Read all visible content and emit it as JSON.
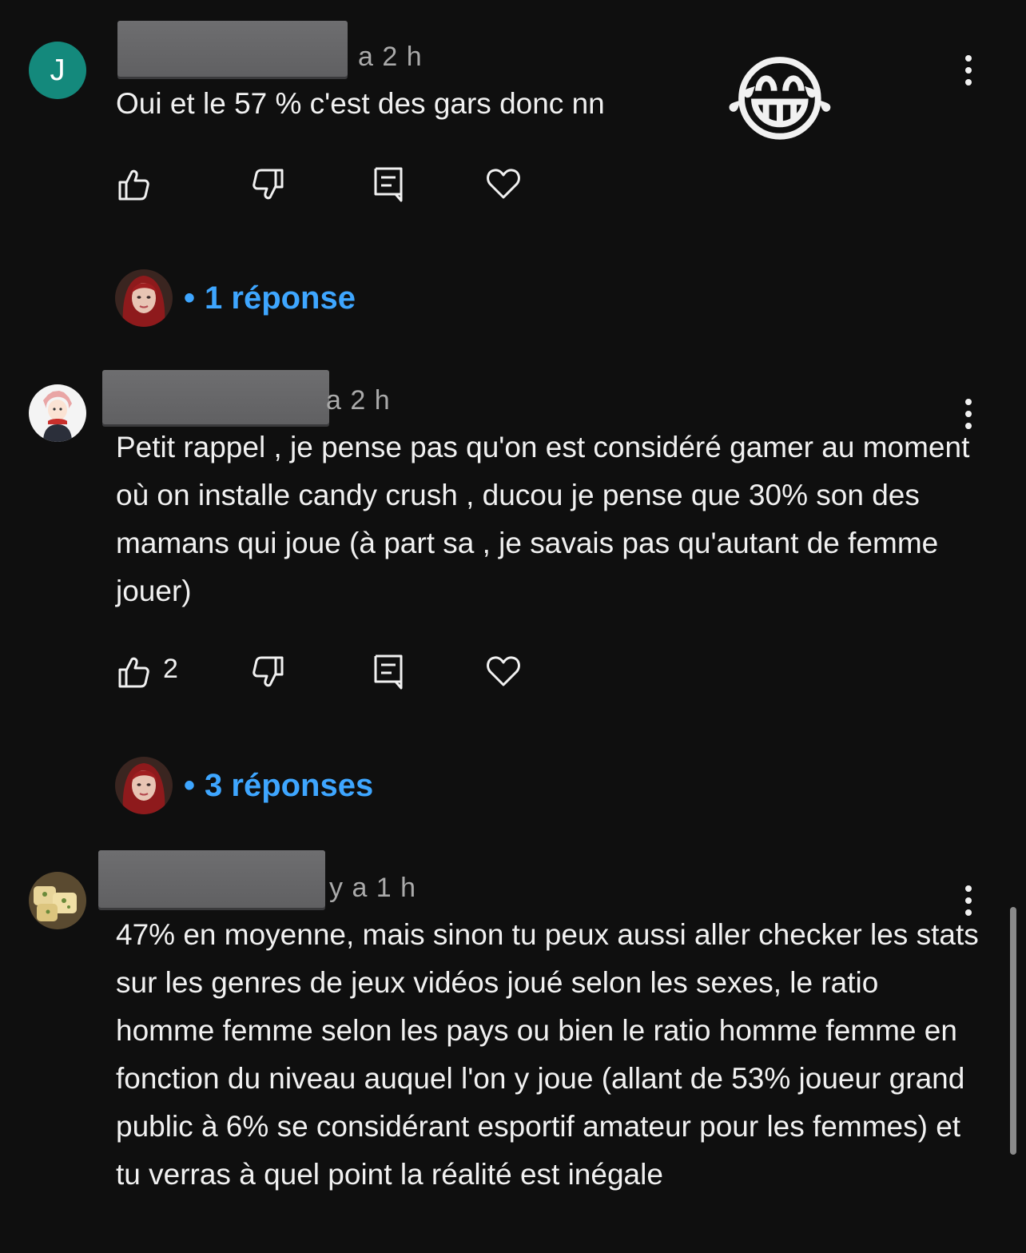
{
  "comments": [
    {
      "avatar_letter": "J",
      "time": "a 2 h",
      "text": "Oui et le 57 % c'est des gars donc nn",
      "emoji": "😂",
      "like_count": "",
      "replies_label": "1 réponse"
    },
    {
      "avatar_letter": "",
      "time": "a 2 h",
      "text": "Petit rappel , je pense pas qu'on est considéré gamer au moment où on installe candy crush , ducou je pense que 30% son des mamans qui joue (à part sa , je savais pas qu'autant de femme jouer)",
      "emoji": "",
      "like_count": "2",
      "replies_label": "3 réponses"
    },
    {
      "avatar_letter": "",
      "time": "y a 1 h",
      "text": "47% en moyenne, mais sinon tu peux aussi aller checker les stats sur les genres de jeux vidéos joué selon les sexes, le ratio homme femme selon les pays ou bien le ratio homme femme en fonction du niveau auquel l'on y joue (allant de 53% joueur grand public à 6% se considérant esportif amateur pour les femmes) et tu verras à quel point la réalité est inégale",
      "emoji": "",
      "like_count": "",
      "replies_label": ""
    }
  ],
  "icons": {
    "like": "thumbs-up-icon",
    "dislike": "thumbs-down-icon",
    "reply": "reply-icon",
    "heart": "heart-icon",
    "more": "more-vertical-icon"
  },
  "colors": {
    "background": "#0f0f0f",
    "text": "#f1f1f1",
    "muted": "#aaaaaa",
    "link": "#3ea6ff",
    "avatar_j": "#14897c"
  }
}
